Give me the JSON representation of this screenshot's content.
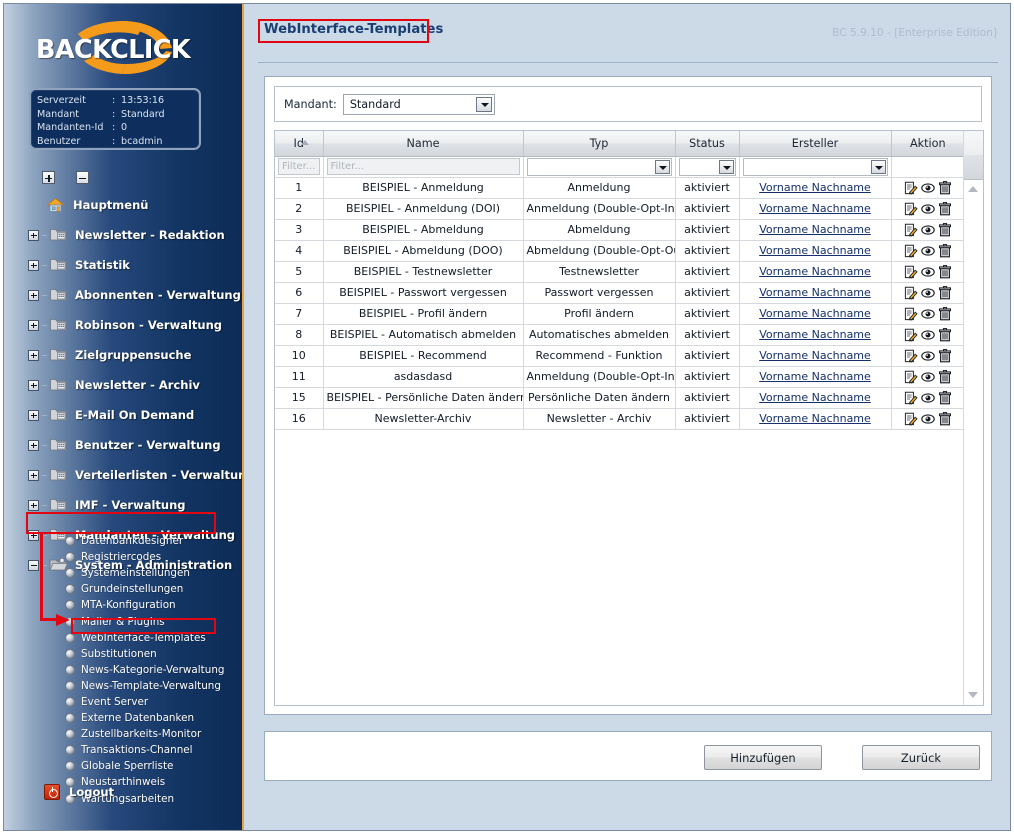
{
  "app": {
    "brand": "BACKCLICK",
    "version_label": "BC 5.9.10 - [Enterprise Edition]"
  },
  "info_box": {
    "rows": [
      {
        "label": "Serverzeit",
        "sep": ":",
        "value": "13:53:16"
      },
      {
        "label": "Mandant",
        "sep": ":",
        "value": "Standard"
      },
      {
        "label": "Mandanten-Id",
        "sep": ":",
        "value": "0"
      },
      {
        "label": "Benutzer",
        "sep": ":",
        "value": "bcadmin"
      }
    ]
  },
  "tree_controls": {
    "expand_all": "expand-all",
    "collapse_all": "collapse-all"
  },
  "sidebar": {
    "items": [
      {
        "label": "Hauptmenü",
        "icon": "home-icon",
        "expander": "none"
      },
      {
        "label": "Newsletter - Redaktion",
        "icon": "folder-icon",
        "expander": "plus"
      },
      {
        "label": "Statistik",
        "icon": "folder-icon",
        "expander": "plus"
      },
      {
        "label": "Abonnenten - Verwaltung",
        "icon": "folder-icon",
        "expander": "plus"
      },
      {
        "label": "Robinson - Verwaltung",
        "icon": "folder-icon",
        "expander": "plus"
      },
      {
        "label": "Zielgruppensuche",
        "icon": "folder-icon",
        "expander": "plus"
      },
      {
        "label": "Newsletter - Archiv",
        "icon": "folder-icon",
        "expander": "plus"
      },
      {
        "label": "E-Mail On Demand",
        "icon": "folder-icon",
        "expander": "plus"
      },
      {
        "label": "Benutzer - Verwaltung",
        "icon": "folder-icon",
        "expander": "plus"
      },
      {
        "label": "Verteilerlisten - Verwaltung",
        "icon": "folder-icon",
        "expander": "plus"
      },
      {
        "label": "IMF - Verwaltung",
        "icon": "folder-icon",
        "expander": "plus"
      },
      {
        "label": "Mandanten - Verwaltung",
        "icon": "folder-icon",
        "expander": "plus"
      },
      {
        "label": "System - Administration",
        "icon": "folder-open-icon",
        "expander": "minus"
      }
    ],
    "sub_items": [
      {
        "label": "Datenbankdesigner"
      },
      {
        "label": "Registriercodes"
      },
      {
        "label": "Systemeinstellungen"
      },
      {
        "label": "Grundeinstellungen"
      },
      {
        "label": "MTA-Konfiguration"
      },
      {
        "label": "Mailer & Plugins"
      },
      {
        "label": "WebInterface-Templates"
      },
      {
        "label": "Substitutionen"
      },
      {
        "label": "News-Kategorie-Verwaltung"
      },
      {
        "label": "News-Template-Verwaltung"
      },
      {
        "label": "Event Server"
      },
      {
        "label": "Externe Datenbanken"
      },
      {
        "label": "Zustellbarkeits-Monitor"
      },
      {
        "label": "Transaktions-Channel"
      },
      {
        "label": "Globale Sperrliste"
      },
      {
        "label": "Neustarthinweis"
      },
      {
        "label": "Wartungsarbeiten"
      }
    ],
    "logout": "Logout"
  },
  "main": {
    "title": "WebInterface-Templates",
    "mandant": {
      "label": "Mandant:",
      "value": "Standard"
    },
    "table": {
      "columns": [
        "Id",
        "Name",
        "Typ",
        "Status",
        "Ersteller",
        "Aktion"
      ],
      "sorted_column": "Id",
      "sort_direction": "asc",
      "filters": {
        "id_placeholder": "Filter...",
        "name_placeholder": "Filter...",
        "typ_value": "",
        "status_value": "",
        "ersteller_value": ""
      },
      "rows": [
        {
          "id": "1",
          "name": "BEISPIEL - Anmeldung",
          "typ": "Anmeldung",
          "status": "aktiviert",
          "ersteller": "Vorname Nachname"
        },
        {
          "id": "2",
          "name": "BEISPIEL - Anmeldung (DOI)",
          "typ": "Anmeldung (Double-Opt-In)",
          "status": "aktiviert",
          "ersteller": "Vorname Nachname"
        },
        {
          "id": "3",
          "name": "BEISPIEL - Abmeldung",
          "typ": "Abmeldung",
          "status": "aktiviert",
          "ersteller": "Vorname Nachname"
        },
        {
          "id": "4",
          "name": "BEISPIEL - Abmeldung (DOO)",
          "typ": "Abmeldung (Double-Opt-Out)",
          "status": "aktiviert",
          "ersteller": "Vorname Nachname"
        },
        {
          "id": "5",
          "name": "BEISPIEL - Testnewsletter",
          "typ": "Testnewsletter",
          "status": "aktiviert",
          "ersteller": "Vorname Nachname"
        },
        {
          "id": "6",
          "name": "BEISPIEL - Passwort vergessen",
          "typ": "Passwort vergessen",
          "status": "aktiviert",
          "ersteller": "Vorname Nachname"
        },
        {
          "id": "7",
          "name": "BEISPIEL - Profil ändern",
          "typ": "Profil ändern",
          "status": "aktiviert",
          "ersteller": "Vorname Nachname"
        },
        {
          "id": "8",
          "name": "BEISPIEL - Automatisch abmelden",
          "typ": "Automatisches abmelden",
          "status": "aktiviert",
          "ersteller": "Vorname Nachname"
        },
        {
          "id": "10",
          "name": "BEISPIEL - Recommend",
          "typ": "Recommend - Funktion",
          "status": "aktiviert",
          "ersteller": "Vorname Nachname"
        },
        {
          "id": "11",
          "name": "asdasdasd",
          "typ": "Anmeldung (Double-Opt-In)",
          "status": "aktiviert",
          "ersteller": "Vorname Nachname"
        },
        {
          "id": "15",
          "name": "BEISPIEL - Persönliche Daten ändern",
          "typ": "Persönliche Daten ändern",
          "status": "aktiviert",
          "ersteller": "Vorname Nachname"
        },
        {
          "id": "16",
          "name": "Newsletter-Archiv",
          "typ": "Newsletter - Archiv",
          "status": "aktiviert",
          "ersteller": "Vorname Nachname"
        }
      ],
      "row_actions": [
        "edit-icon",
        "preview-eye-icon",
        "delete-trash-icon"
      ]
    },
    "buttons": {
      "add": "Hinzufügen",
      "back": "Zurück"
    }
  },
  "annotations": {
    "highlight_color": "#e20613",
    "highlighted": [
      "WebInterface-Templates",
      "System - Administration",
      "WebInterface-Templates"
    ]
  }
}
